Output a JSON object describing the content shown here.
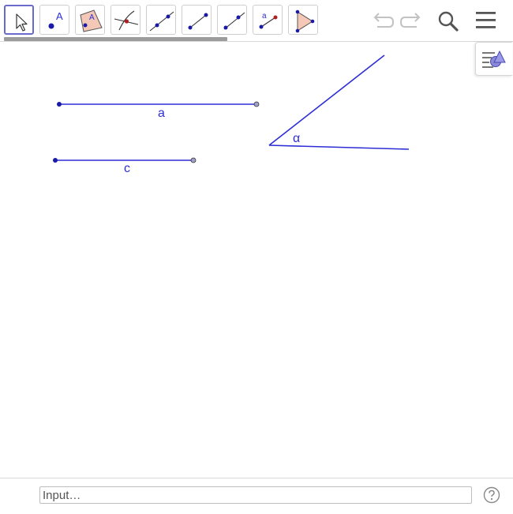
{
  "toolbar": {
    "tools": [
      {
        "name": "move"
      },
      {
        "name": "point",
        "glyph": "A"
      },
      {
        "name": "polygon",
        "glyph": "A"
      },
      {
        "name": "intersect"
      },
      {
        "name": "line"
      },
      {
        "name": "segment"
      },
      {
        "name": "ray"
      },
      {
        "name": "segment-with-length",
        "glyph": "a"
      },
      {
        "name": "polygon-tool"
      }
    ],
    "actions": [
      "undo-icon",
      "redo-icon",
      "search-icon",
      "menu-icon"
    ]
  },
  "canvas": {
    "segment_a_label": "a",
    "segment_c_label": "c",
    "angle_label": "α"
  },
  "input": {
    "placeholder": "Input…"
  },
  "colors": {
    "object": "#2d2dd6",
    "point": "#1a1aa8",
    "selected_border": "#6a6acd"
  }
}
